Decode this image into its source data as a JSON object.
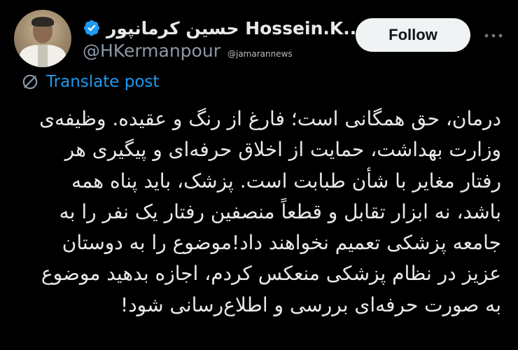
{
  "author": {
    "display_name": "حسین کرمانپور Hossein.K...",
    "handle": "@HKermanpour",
    "verified": true
  },
  "watermark": "@jamarannews",
  "follow_button": {
    "label": "Follow"
  },
  "more_button": {
    "icon": "more-horizontal-icon"
  },
  "translate": {
    "label": "Translate post",
    "icon": "translate-globe-icon"
  },
  "post": {
    "text": "درمان، حق همگانی است؛ فارغ از رنگ و عقیده. وظیفه‌ی\nوزارت بهداشت، حمایت از اخلاق حرفه‌ای و پیگیری هر\nرفتار مغایر با شأن طبابت است. پزشک، باید پناه همه\nباشد، نه ابزار تقابل و قطعاً منصفین رفتار یک نفر را به\nجامعه پزشکی تعمیم نخواهند داد!موضوع را به دوستان\nعزیز در نظام پزشکی منعکس کردم، اجازه بدهید موضوع\nبه صورت حرفه‌ای بررسی و اطلاع‌رسانی شود!"
  },
  "colors": {
    "background": "#000000",
    "text": "#e7e9ea",
    "secondary_text": "#8b98a5",
    "link_blue": "#1d9bf0",
    "verified_blue": "#1d9bf0",
    "follow_bg": "#eff3f4"
  }
}
